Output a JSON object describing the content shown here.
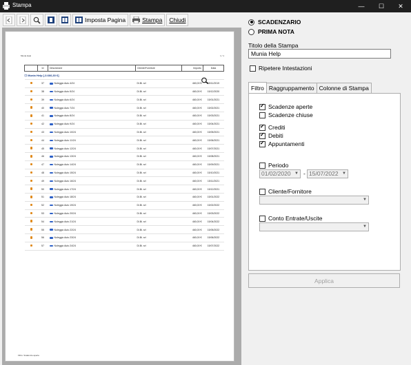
{
  "window": {
    "title": "Stampa",
    "minimize": "—",
    "maximize": "☐",
    "close": "✕"
  },
  "toolbar": {
    "imposta_pagina": "Imposta Pagina",
    "stampa": "Stampa",
    "chiudi": "Chiudi"
  },
  "report": {
    "page_header": "Munia Help",
    "page_number": "1 / 1",
    "columns": [
      "",
      "Id",
      "Descrizione",
      "Cliente/Fornitore",
      "Importo",
      "Data"
    ],
    "group_label": "☐ Munia Help [-3.666,30 €]",
    "rows": [
      {
        "id": "37",
        "desc": "Noleggio Auto 4/24",
        "cli": "Di.Bi. srl",
        "imp": "460,00 €",
        "data": "15/11/2019"
      },
      {
        "id": "38",
        "desc": "Noleggio Auto 5/24",
        "cli": "Di.Bi. srl",
        "imp": "460,00 €",
        "data": "15/12/2020"
      },
      {
        "id": "39",
        "desc": "Noleggio Auto 6/24",
        "cli": "Di.Bi. srl",
        "imp": "460,00 €",
        "data": "15/01/2021"
      },
      {
        "id": "40",
        "desc": "Noleggio Auto 7/24",
        "cli": "Di.Bi. srl",
        "imp": "460,00 €",
        "data": "15/02/2021"
      },
      {
        "id": "41",
        "desc": "Noleggio Auto 8/24",
        "cli": "Di.Bi. srl",
        "imp": "460,00 €",
        "data": "15/03/2021"
      },
      {
        "id": "42",
        "desc": "Noleggio Auto 9/24",
        "cli": "Di.Bi. srl",
        "imp": "460,00 €",
        "data": "15/04/2021"
      },
      {
        "id": "43",
        "desc": "Noleggio Auto 10/24",
        "cli": "Di.Bi. srl",
        "imp": "460,00 €",
        "data": "15/05/2021"
      },
      {
        "id": "44",
        "desc": "Noleggio Auto 11/24",
        "cli": "Di.Bi. srl",
        "imp": "460,00 €",
        "data": "15/06/2021"
      },
      {
        "id": "45",
        "desc": "Noleggio Auto 12/24",
        "cli": "Di.Bi. srl",
        "imp": "460,00 €",
        "data": "15/07/2021"
      },
      {
        "id": "46",
        "desc": "Noleggio Auto 13/24",
        "cli": "Di.Bi. srl",
        "imp": "460,00 €",
        "data": "15/08/2021"
      },
      {
        "id": "47",
        "desc": "Noleggio Auto 14/24",
        "cli": "Di.Bi. srl",
        "imp": "460,00 €",
        "data": "15/09/2021"
      },
      {
        "id": "48",
        "desc": "Noleggio Auto 15/24",
        "cli": "Di.Bi. srl",
        "imp": "460,00 €",
        "data": "15/10/2021"
      },
      {
        "id": "49",
        "desc": "Noleggio Auto 16/24",
        "cli": "Di.Bi. srl",
        "imp": "460,00 €",
        "data": "15/11/2021"
      },
      {
        "id": "50",
        "desc": "Noleggio Auto 17/24",
        "cli": "Di.Bi. srl",
        "imp": "460,00 €",
        "data": "15/12/2021"
      },
      {
        "id": "51",
        "desc": "Noleggio Auto 18/24",
        "cli": "Di.Bi. srl",
        "imp": "460,00 €",
        "data": "15/01/2022"
      },
      {
        "id": "52",
        "desc": "Noleggio Auto 19/24",
        "cli": "Di.Bi. srl",
        "imp": "460,00 €",
        "data": "15/02/2022"
      },
      {
        "id": "53",
        "desc": "Noleggio Auto 20/24",
        "cli": "Di.Bi. srl",
        "imp": "460,00 €",
        "data": "15/03/2022"
      },
      {
        "id": "54",
        "desc": "Noleggio Auto 21/24",
        "cli": "Di.Bi. srl",
        "imp": "460,00 €",
        "data": "15/04/2022"
      },
      {
        "id": "55",
        "desc": "Noleggio Auto 22/24",
        "cli": "Di.Bi. srl",
        "imp": "460,00 €",
        "data": "15/05/2022"
      },
      {
        "id": "56",
        "desc": "Noleggio Auto 23/24",
        "cli": "Di.Bi. srl",
        "imp": "460,00 €",
        "data": "15/06/2022"
      },
      {
        "id": "57",
        "desc": "Noleggio Auto 24/24",
        "cli": "Di.Bi. srl",
        "imp": "460,00 €",
        "data": "15/07/2022"
      }
    ],
    "footer": "Filtro: Scadenze aperte"
  },
  "options": {
    "scadenzario": "SCADENZARIO",
    "prima_nota": "PRIMA NOTA",
    "titolo_label": "Titolo della Stampa",
    "titolo_value": "Munia Help",
    "ripetere": "Ripetere Intestazioni"
  },
  "tabs": [
    "Filtro",
    "Raggruppamento",
    "Colonne di Stampa"
  ],
  "filtro": {
    "scadenze_aperte": "Scadenze aperte",
    "scadenze_chiuse": "Scadenze chiuse",
    "crediti": "Crediti",
    "debiti": "Debiti",
    "appuntamenti": "Appuntamenti",
    "periodo": "Periodo",
    "date_from": "01/02/2020",
    "date_to": "15/07/2022",
    "date_sep": "-",
    "cliente": "Cliente/Fornitore",
    "conto": "Conto Entrate/Uscite"
  },
  "applica": "Applica"
}
